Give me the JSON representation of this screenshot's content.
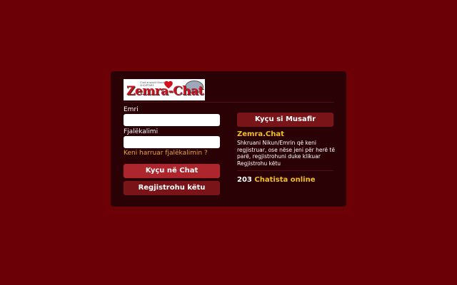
{
  "logo": {
    "small_text": "Chat anglisht Bisedë SHQIPTARË",
    "main_text": "Zemra-Chat"
  },
  "login": {
    "name_label": "Emri",
    "name_value": "",
    "password_label": "Fjalëkalimi",
    "password_value": "",
    "forgot_link": "Keni harruar fjalëkalimin ?",
    "login_button": "Kyçu në Chat",
    "register_button": "Regjistrohu këtu"
  },
  "guest": {
    "button": "Kyçu si Musafir",
    "brand": "Zemra.Chat",
    "description": "Shkruani Nikun/Emrin që keni regjistruar, ose nëse jeni për herë të parë, regjistrohuni duke klikuar Regjistrohu këtu"
  },
  "online": {
    "count": "203",
    "label": "Chatista online"
  },
  "colors": {
    "background": "#6b0106",
    "panel": "#2a0104",
    "primary_button": "#ad262d",
    "secondary_button": "#791419",
    "accent_yellow": "#f2c025",
    "link_orange": "#e9a832"
  }
}
